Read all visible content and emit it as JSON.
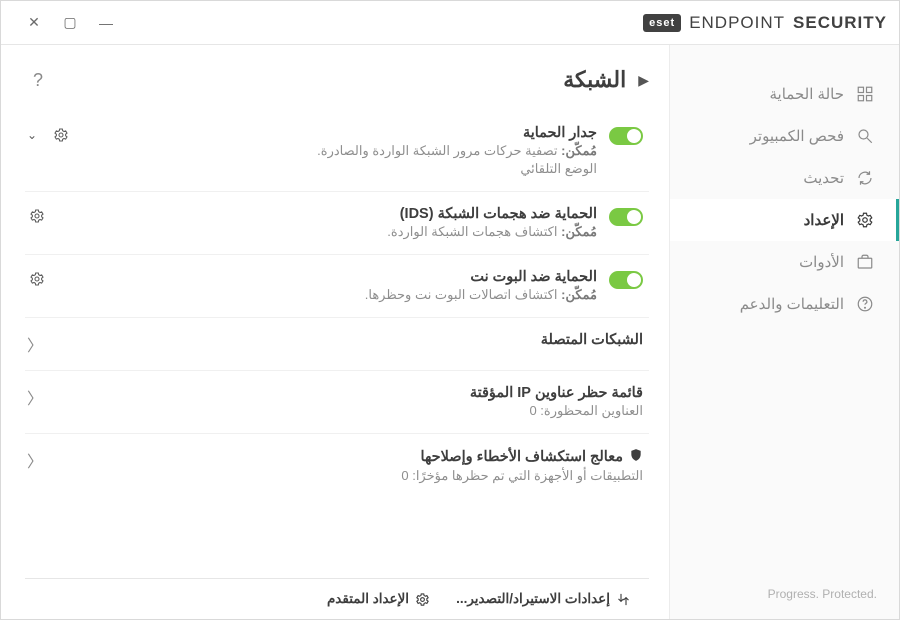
{
  "brand": {
    "logo": "eset",
    "name_thin": "ENDPOINT",
    "name_bold": "SECURITY"
  },
  "sidebar": {
    "items": [
      {
        "label": "حالة الحماية"
      },
      {
        "label": "فحص الكمبيوتر"
      },
      {
        "label": "تحديث"
      },
      {
        "label": "الإعداد"
      },
      {
        "label": "الأدوات"
      },
      {
        "label": "التعليمات والدعم"
      }
    ],
    "tagline": "Progress. Protected."
  },
  "page": {
    "title": "الشبكة"
  },
  "settings": [
    {
      "title": "جدار الحماية",
      "status_prefix": "مُمكّن:",
      "status_text": "تصفية حركات مرور الشبكة الواردة والصادرة.",
      "extra": "الوضع التلقائي",
      "toggle": true,
      "has_dropdown": true
    },
    {
      "title": "الحماية ضد هجمات الشبكة (IDS)",
      "status_prefix": "مُمكّن:",
      "status_text": "اكتشاف هجمات الشبكة الواردة.",
      "toggle": true,
      "has_dropdown": false
    },
    {
      "title": "الحماية ضد البوت نت",
      "status_prefix": "مُمكّن:",
      "status_text": "اكتشاف اتصالات البوت نت وحظرها.",
      "toggle": true,
      "has_dropdown": false
    }
  ],
  "navs": [
    {
      "title": "الشبكات المتصلة",
      "sub": ""
    },
    {
      "title": "قائمة حظر عناوين IP المؤقتة",
      "sub": "العناوين المحظورة: 0"
    },
    {
      "title": "معالج استكشاف الأخطاء وإصلاحها",
      "sub": "التطبيقات أو الأجهزة التي تم حظرها مؤخرًا: 0",
      "icon": "shield"
    }
  ],
  "footer": {
    "import_export": "إعدادات الاستيراد/التصدير...",
    "advanced": "الإعداد المتقدم"
  }
}
